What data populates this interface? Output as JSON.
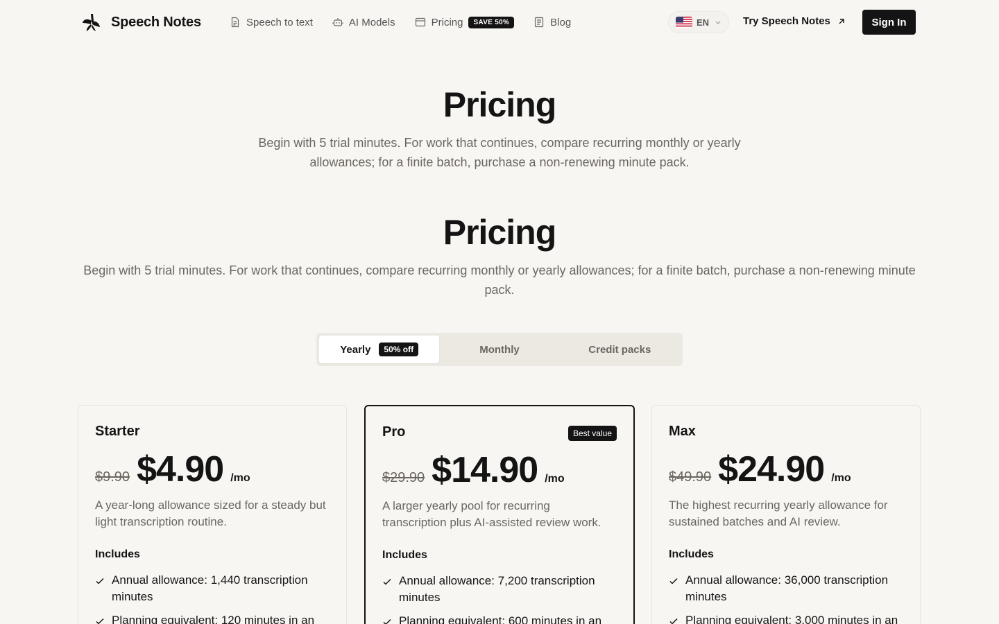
{
  "nav": {
    "brand": "Speech Notes",
    "links": [
      {
        "label": "Speech to text",
        "icon": "document-icon"
      },
      {
        "label": "AI Models",
        "icon": "robot-icon"
      },
      {
        "label": "Pricing",
        "icon": "pricing-icon",
        "badge": "SAVE 50%"
      },
      {
        "label": "Blog",
        "icon": "blog-icon"
      }
    ],
    "language": "EN",
    "try_label": "Try Speech Notes",
    "signin_label": "Sign In"
  },
  "hero": {
    "title": "Pricing",
    "subtitle": "Begin with 5 trial minutes. For work that continues, compare recurring monthly or yearly allowances; for a finite batch, purchase a non-renewing minute pack."
  },
  "section": {
    "title": "Pricing",
    "subtitle": "Begin with 5 trial minutes. For work that continues, compare recurring monthly or yearly allowances; for a finite batch, purchase a non-renewing minute pack."
  },
  "toggle": {
    "tabs": [
      {
        "label": "Yearly",
        "badge": "50% off",
        "active": true
      },
      {
        "label": "Monthly",
        "active": false
      },
      {
        "label": "Credit packs",
        "active": false
      }
    ]
  },
  "plans": [
    {
      "name": "Starter",
      "old_price": "$9.90",
      "price": "$4.90",
      "period": "/mo",
      "description": "A year-long allowance sized for a steady but light transcription routine.",
      "includes_label": "Includes",
      "features": [
        "Annual allowance: 1,440 transcription minutes",
        "Planning equivalent: 120 minutes in an"
      ]
    },
    {
      "name": "Pro",
      "badge": "Best value",
      "old_price": "$29.90",
      "price": "$14.90",
      "period": "/mo",
      "description": "A larger yearly pool for recurring transcription plus AI-assisted review work.",
      "includes_label": "Includes",
      "features": [
        "Annual allowance: 7,200 transcription minutes",
        "Planning equivalent: 600 minutes in an"
      ]
    },
    {
      "name": "Max",
      "old_price": "$49.90",
      "price": "$24.90",
      "period": "/mo",
      "description": "The highest recurring yearly allowance for sustained batches and AI review.",
      "includes_label": "Includes",
      "features": [
        "Annual allowance: 36,000 transcription minutes",
        "Planning equivalent: 3,000 minutes in an"
      ]
    }
  ]
}
